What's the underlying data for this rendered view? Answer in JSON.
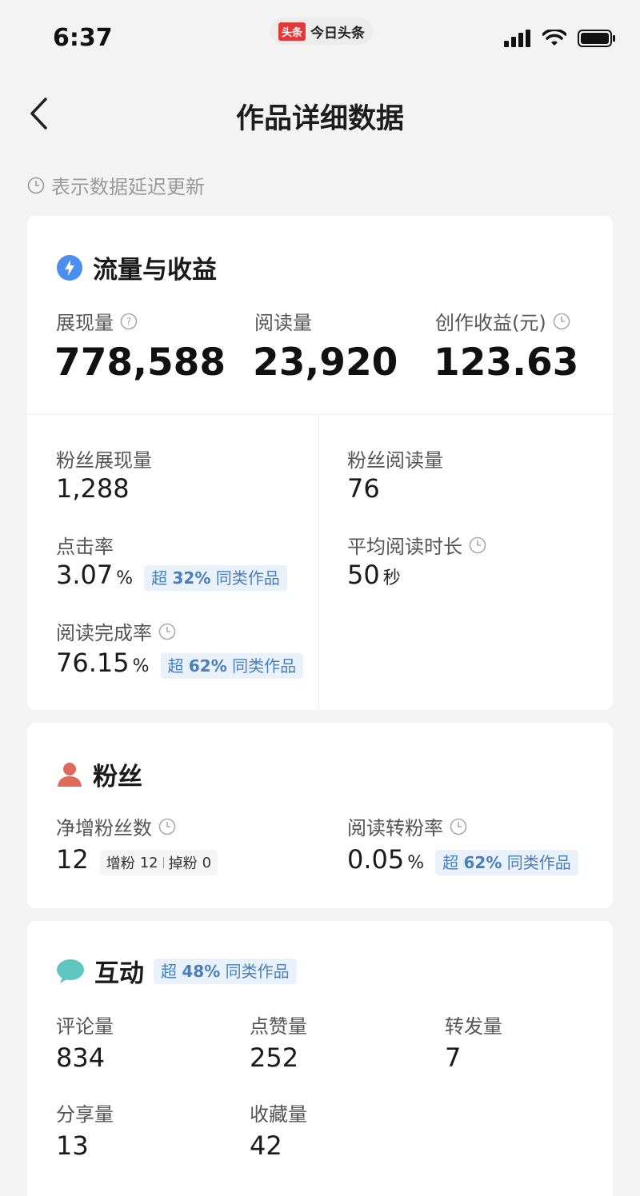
{
  "status_bar": {
    "time": "6:37",
    "app_logo": "头条",
    "app_name": "今日头条"
  },
  "nav": {
    "title": "作品详细数据"
  },
  "delay_note": "表示数据延迟更新",
  "traffic": {
    "title": "流量与收益",
    "impressions": {
      "label": "展现量",
      "value": "778,588"
    },
    "reads": {
      "label": "阅读量",
      "value": "23,920"
    },
    "earnings": {
      "label": "创作收益(元)",
      "value": "123.63"
    },
    "fan_impressions": {
      "label": "粉丝展现量",
      "value": "1,288"
    },
    "fan_reads": {
      "label": "粉丝阅读量",
      "value": "76"
    },
    "ctr": {
      "label": "点击率",
      "value": "3.07",
      "unit": "%",
      "badge_prefix": "超",
      "badge_pct": "32%",
      "badge_suffix": "同类作品"
    },
    "avg_read_time": {
      "label": "平均阅读时长",
      "value": "50",
      "unit": "秒"
    },
    "completion": {
      "label": "阅读完成率",
      "value": "76.15",
      "unit": "%",
      "badge_prefix": "超",
      "badge_pct": "62%",
      "badge_suffix": "同类作品"
    }
  },
  "fans": {
    "title": "粉丝",
    "net_growth": {
      "label": "净增粉丝数",
      "value": "12",
      "gain_label": "增粉",
      "gain": "12",
      "loss_label": "掉粉",
      "loss": "0"
    },
    "conversion": {
      "label": "阅读转粉率",
      "value": "0.05",
      "unit": "%",
      "badge_prefix": "超",
      "badge_pct": "62%",
      "badge_suffix": "同类作品"
    }
  },
  "interaction": {
    "title": "互动",
    "badge_prefix": "超",
    "badge_pct": "48%",
    "badge_suffix": "同类作品",
    "comments": {
      "label": "评论量",
      "value": "834"
    },
    "likes": {
      "label": "点赞量",
      "value": "252"
    },
    "reposts": {
      "label": "转发量",
      "value": "7"
    },
    "shares": {
      "label": "分享量",
      "value": "13"
    },
    "favorites": {
      "label": "收藏量",
      "value": "42"
    }
  },
  "colors": {
    "accent_blue": "#4a7fbe",
    "badge_bg": "#e9f1fb",
    "traffic_icon": "#4a8ef0",
    "fans_icon": "#e06a5a",
    "interaction_icon": "#5fc7c0"
  }
}
